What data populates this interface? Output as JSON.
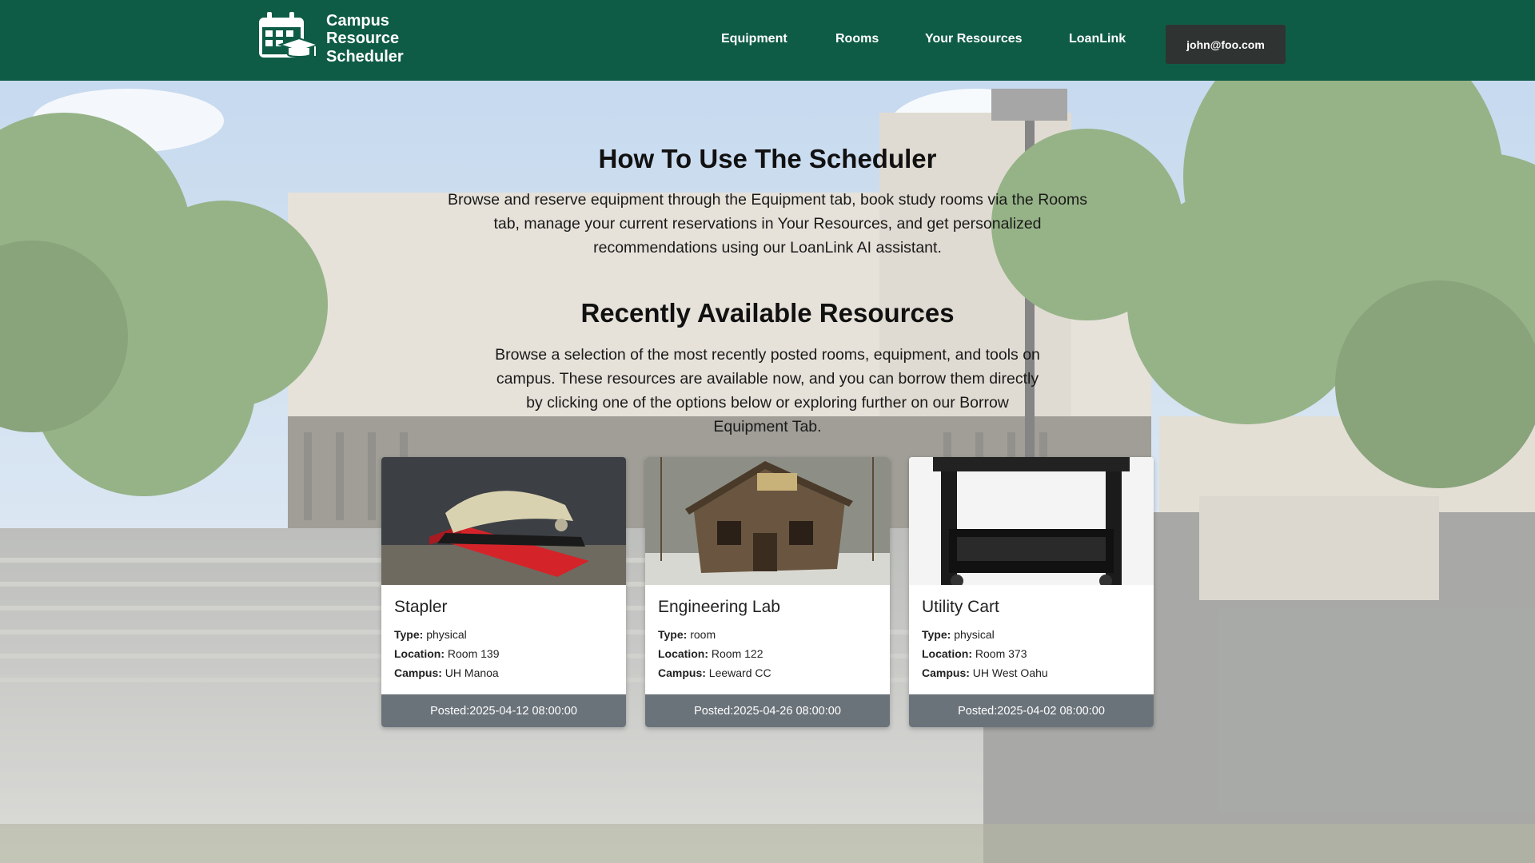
{
  "header": {
    "brand_lines": [
      "Campus",
      "Resource",
      "Scheduler"
    ],
    "nav": [
      {
        "label": "Equipment"
      },
      {
        "label": "Rooms"
      },
      {
        "label": "Your Resources"
      },
      {
        "label": "LoanLink"
      }
    ],
    "user_email": "john@foo.com",
    "brand_icon": "calendar-graduation-cap-icon"
  },
  "how_to": {
    "title": "How To Use The Scheduler",
    "text": "Browse and reserve equipment through the Equipment tab, book study rooms via the Rooms tab, manage your current reservations in Your Resources, and get personalized recommendations using our LoanLink AI assistant."
  },
  "recent": {
    "title": "Recently Available Resources",
    "text": "Browse a selection of the most recently posted rooms, equipment, and tools on campus. These resources are available now, and you can borrow them directly by clicking one of the options below or exploring further on our Borrow Equipment Tab."
  },
  "labels": {
    "type": "Type:",
    "location": "Location:",
    "campus": "Campus:",
    "posted": "Posted:"
  },
  "cards": [
    {
      "title": "Stapler",
      "type": "physical",
      "location": "Room 139",
      "campus": "UH Manoa",
      "posted": "Posted:2025-04-12 08:00:00"
    },
    {
      "title": "Engineering Lab",
      "type": "room",
      "location": "Room 122",
      "campus": "Leeward CC",
      "posted": "Posted:2025-04-26 08:00:00"
    },
    {
      "title": "Utility Cart",
      "type": "physical",
      "location": "Room 373",
      "campus": "UH West Oahu",
      "posted": "Posted:2025-04-02 08:00:00"
    }
  ],
  "colors": {
    "header_bg": "#0f5c46",
    "user_button_bg": "#2f3331",
    "card_footer_bg": "#6b737a"
  }
}
